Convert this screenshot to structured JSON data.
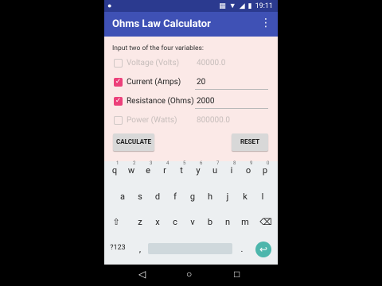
{
  "status": {
    "time": "19:11"
  },
  "app": {
    "title": "Ohms Law Calculator"
  },
  "content": {
    "instruction": "Input two of the four variables:",
    "rows": [
      {
        "label": "Voltage (Volts)",
        "value": "40000.0",
        "checked": false,
        "enabled": false
      },
      {
        "label": "Current (Amps)",
        "value": "20",
        "checked": true,
        "enabled": true
      },
      {
        "label": "Resistance (Ohms)",
        "value": "2000",
        "checked": true,
        "enabled": true
      },
      {
        "label": "Power (Watts)",
        "value": "800000.0",
        "checked": false,
        "enabled": false
      }
    ],
    "buttons": {
      "calculate": "CALCULATE",
      "reset": "RESET"
    }
  },
  "keyboard": {
    "row1": [
      "q",
      "w",
      "e",
      "r",
      "t",
      "y",
      "u",
      "i",
      "o",
      "p"
    ],
    "row1_hints": [
      "1",
      "2",
      "3",
      "4",
      "5",
      "6",
      "7",
      "8",
      "9",
      "0"
    ],
    "row2": [
      "a",
      "s",
      "d",
      "f",
      "g",
      "h",
      "j",
      "k",
      "l"
    ],
    "row3": [
      "z",
      "x",
      "c",
      "v",
      "b",
      "n",
      "m"
    ],
    "symbols": "?123",
    "comma": ",",
    "period": "."
  },
  "colors": {
    "accent": "#ec407a",
    "appbar": "#3f51b5",
    "statusbar": "#2b3a8f",
    "enter": "#4db6ac"
  }
}
